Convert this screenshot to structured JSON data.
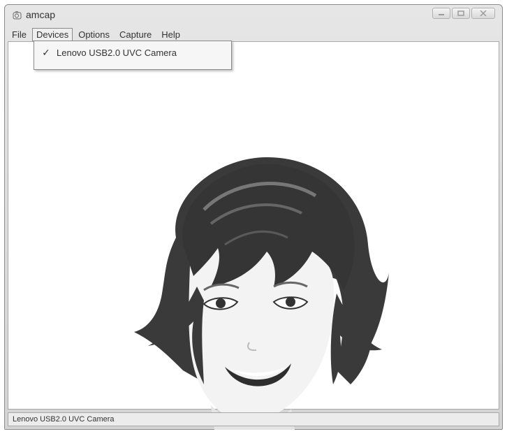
{
  "window": {
    "title": "amcap",
    "app_icon": "camera-app-icon",
    "caption_buttons": [
      "minimize-icon",
      "maximize-icon",
      "close-icon"
    ]
  },
  "menubar": {
    "items": [
      {
        "label": "File"
      },
      {
        "label": "Devices",
        "active": true
      },
      {
        "label": "Options"
      },
      {
        "label": "Capture"
      },
      {
        "label": "Help"
      }
    ]
  },
  "devices_menu": {
    "items": [
      {
        "label": "Lenovo USB2.0 UVC Camera",
        "checked": true,
        "check_glyph": "✓"
      }
    ]
  },
  "preview": {
    "content": "camera-preview-face-illustration"
  },
  "statusbar": {
    "text": "Lenovo USB2.0 UVC Camera"
  },
  "colors": {
    "hair": "#3a3a3a",
    "hair_highlight": "#6e6e6e",
    "skin": "#f2f2f2",
    "lips": "#2e2e2e"
  }
}
